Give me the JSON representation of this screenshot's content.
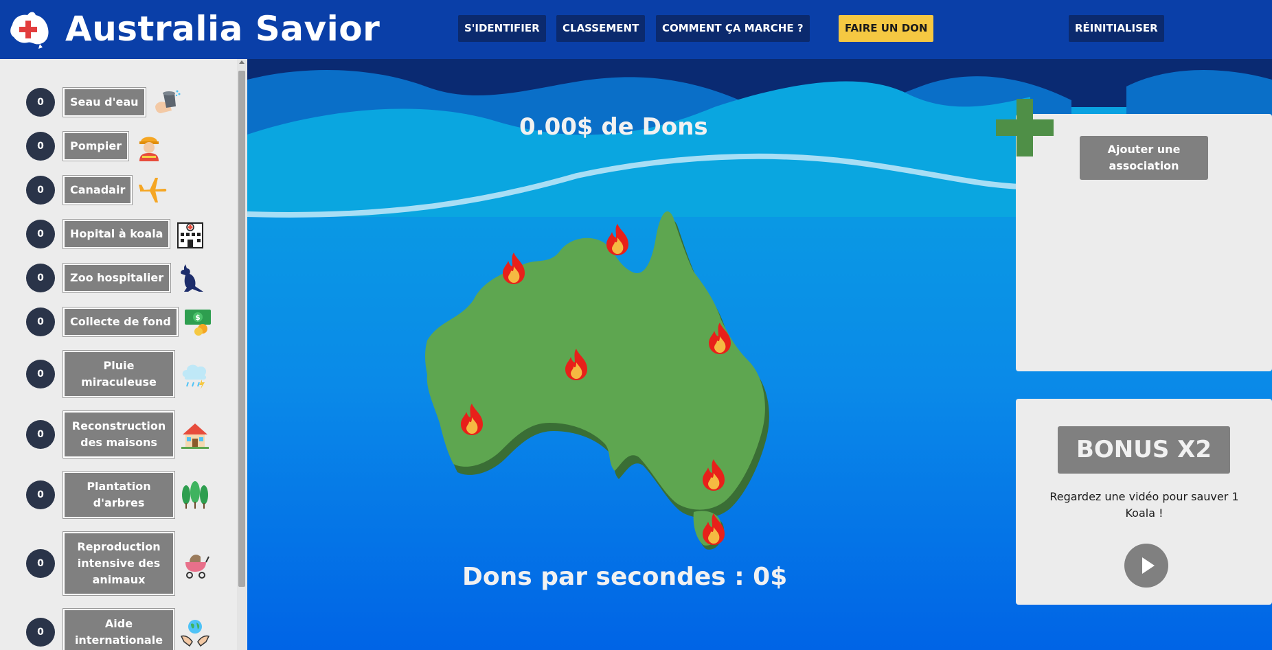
{
  "header": {
    "title": "Australia Savior",
    "nav": {
      "login": "S'IDENTIFIER",
      "ranking": "CLASSEMENT",
      "how": "COMMENT ÇA MARCHE ?",
      "donate": "FAIRE UN DON",
      "reset": "RÉINITIALISER"
    }
  },
  "sidebar": {
    "items": [
      {
        "count": "0",
        "label": "Seau d'eau",
        "icon": "water-bucket-icon"
      },
      {
        "count": "0",
        "label": "Pompier",
        "icon": "firefighter-icon"
      },
      {
        "count": "0",
        "label": "Canadair",
        "icon": "airplane-icon"
      },
      {
        "count": "0",
        "label": "Hopital à koala",
        "icon": "hospital-icon"
      },
      {
        "count": "0",
        "label": "Zoo hospitalier",
        "icon": "kangaroo-icon"
      },
      {
        "count": "0",
        "label": "Collecte de fond",
        "icon": "money-icon"
      },
      {
        "count": "0",
        "label": "Pluie miraculeuse",
        "icon": "rain-cloud-icon"
      },
      {
        "count": "0",
        "label": "Reconstruction des maisons",
        "icon": "house-icon"
      },
      {
        "count": "0",
        "label": "Plantation d'arbres",
        "icon": "trees-icon"
      },
      {
        "count": "0",
        "label": "Reproduction intensive des animaux",
        "icon": "stroller-icon"
      },
      {
        "count": "0",
        "label": "Aide internationale",
        "icon": "globe-hands-icon"
      }
    ]
  },
  "main": {
    "total_donations": "0.00$ de Dons",
    "donations_per_second": "Dons par secondes : 0$",
    "fires_count": 7
  },
  "associations": {
    "add_label": "Ajouter une association"
  },
  "bonus": {
    "button_label": "BONUS X2",
    "text": "Regardez une vidéo pour sauver 1 Koala !"
  },
  "colors": {
    "header_bg": "#0a3fa8",
    "donate_accent": "#f5c842",
    "map_green": "#5ea650",
    "fire_red": "#e8201a"
  }
}
